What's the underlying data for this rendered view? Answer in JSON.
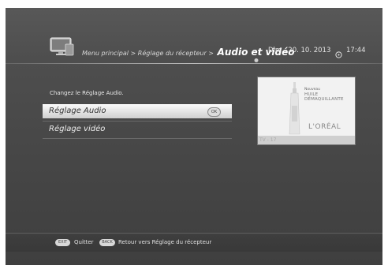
{
  "header": {
    "breadcrumb_root": "Menu principal",
    "breadcrumb_sep1": ">",
    "breadcrumb_parent": "Réglage du récepteur",
    "breadcrumb_sep2": ">",
    "breadcrumb_current": "Audio et vidéo",
    "date": "Dim , 20. 10. 2013",
    "time": "17:44"
  },
  "content": {
    "instruction": "Changez le Réglage Audio.",
    "menu": [
      {
        "label": "Réglage Audio",
        "selected": true,
        "ok_label": "OK"
      },
      {
        "label": "Réglage vidéo",
        "selected": false
      }
    ]
  },
  "preview": {
    "nouveau": "Nouveau",
    "product_line1": "HUILE",
    "product_line2": "DÉMAQUILLANTE",
    "brand": "L'ORÉAL",
    "channel": "TV - 17"
  },
  "footer": {
    "exit_key": "EXIT",
    "exit_label": "Quitter",
    "back_key": "BACK",
    "back_label": "Retour vers Réglage du récepteur"
  },
  "icons": {
    "tv": "tv-settings-icon",
    "clock": "clock-icon"
  }
}
